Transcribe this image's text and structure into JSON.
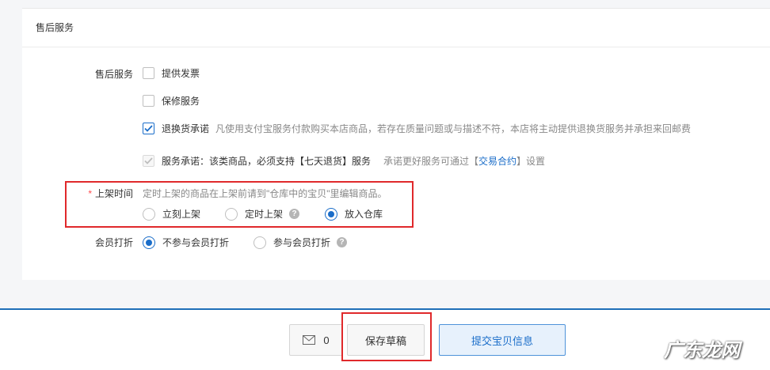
{
  "section": {
    "header_title": "售后服务"
  },
  "after_sales": {
    "label": "售后服务",
    "options": [
      {
        "label": "提供发票",
        "checked": false
      },
      {
        "label": "保修服务",
        "checked": false
      },
      {
        "label": "退换货承诺",
        "checked": true,
        "note": "凡使用支付宝服务付款购买本店商品，若存在质量问题或与描述不符，本店将主动提供退换货服务并承担来回邮费"
      }
    ],
    "promise": {
      "label": "服务承诺：该类商品，必须支持【七天退货】服务",
      "hint_prefix": "承诺更好服务可通过【",
      "hint_link": "交易合约",
      "hint_suffix": "】设置",
      "checked": true,
      "disabled": true
    }
  },
  "listing_time": {
    "required_mark": "*",
    "label": "上架时间",
    "hint": "定时上架的商品在上架前请到\"仓库中的宝贝\"里编辑商品。",
    "options": [
      "立刻上架",
      "定时上架",
      "放入仓库"
    ],
    "selected": "放入仓库",
    "help_icon_text": "?"
  },
  "member_discount": {
    "label": "会员打折",
    "options": [
      "不参与会员打折",
      "参与会员打折"
    ],
    "selected": "不参与会员打折",
    "help_icon_text": "?"
  },
  "footer": {
    "message_count": "0",
    "save_draft": "保存草稿",
    "submit": "提交宝贝信息"
  },
  "watermark": "广东龙网",
  "colors": {
    "accent": "#1a6dc9",
    "highlight_box": "#e0292b",
    "divider": "#1f6fb8"
  }
}
